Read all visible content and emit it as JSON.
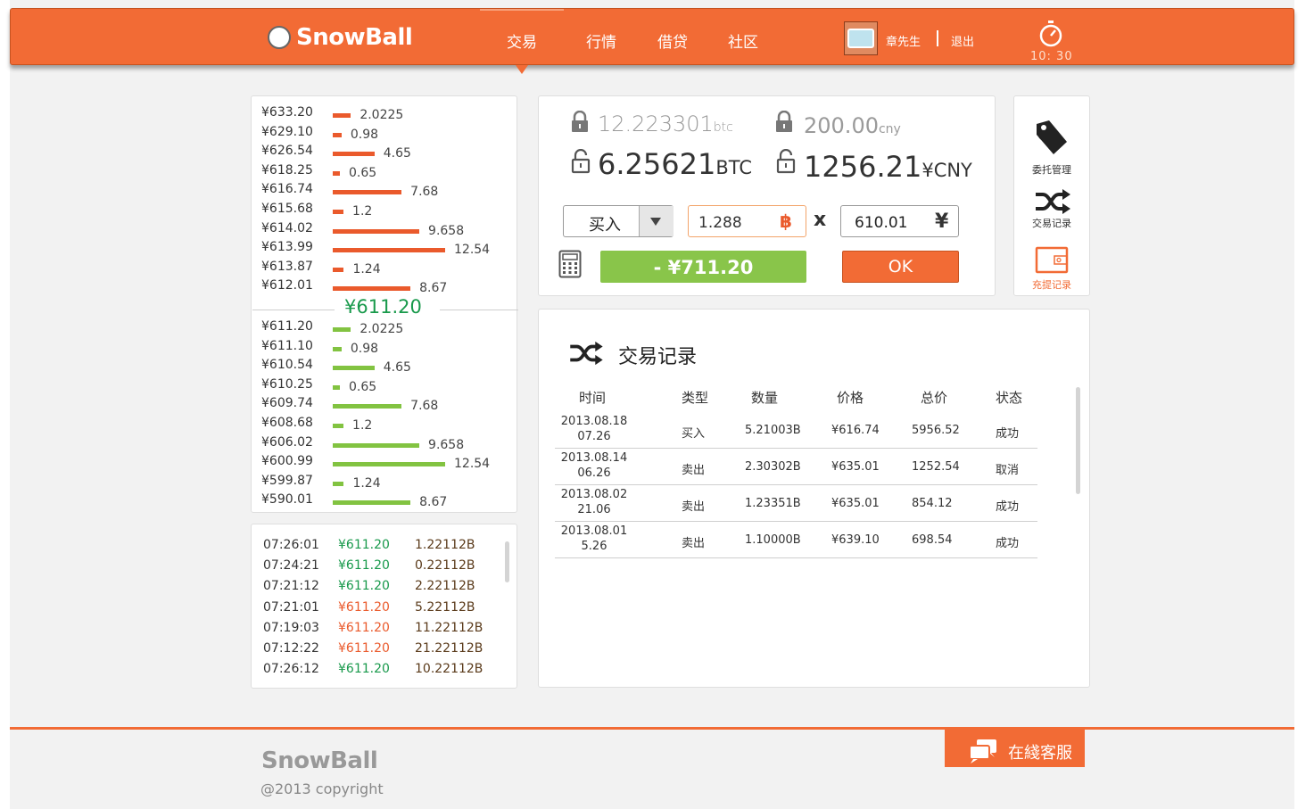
{
  "header": {
    "logo": "SnowBall",
    "nav": [
      "交易",
      "行情",
      "借贷",
      "社区"
    ],
    "active_nav": "交易",
    "username": "章先生",
    "logout": "退出",
    "clock": "10: 30"
  },
  "orderbook": {
    "asks": [
      {
        "price": "¥633.20",
        "qty": "2.0225",
        "amount": 2.0225
      },
      {
        "price": "¥629.10",
        "qty": "0.98",
        "amount": 0.98
      },
      {
        "price": "¥626.54",
        "qty": "4.65",
        "amount": 4.65
      },
      {
        "price": "¥618.25",
        "qty": "0.65",
        "amount": 0.65
      },
      {
        "price": "¥616.74",
        "qty": "7.68",
        "amount": 7.68
      },
      {
        "price": "¥615.68",
        "qty": "1.2",
        "amount": 1.2
      },
      {
        "price": "¥614.02",
        "qty": "9.658",
        "amount": 9.658
      },
      {
        "price": "¥613.99",
        "qty": "12.54",
        "amount": 12.54
      },
      {
        "price": "¥613.87",
        "qty": "1.24",
        "amount": 1.24
      },
      {
        "price": "¥612.01",
        "qty": "8.67",
        "amount": 8.67
      }
    ],
    "mid_price": "¥611.20",
    "bids": [
      {
        "price": "¥611.20",
        "qty": "2.0225",
        "amount": 2.0225
      },
      {
        "price": "¥611.10",
        "qty": "0.98",
        "amount": 0.98
      },
      {
        "price": "¥610.54",
        "qty": "4.65",
        "amount": 4.65
      },
      {
        "price": "¥610.25",
        "qty": "0.65",
        "amount": 0.65
      },
      {
        "price": "¥609.74",
        "qty": "7.68",
        "amount": 7.68
      },
      {
        "price": "¥608.68",
        "qty": "1.2",
        "amount": 1.2
      },
      {
        "price": "¥606.02",
        "qty": "9.658",
        "amount": 9.658
      },
      {
        "price": "¥600.99",
        "qty": "12.54",
        "amount": 12.54
      },
      {
        "price": "¥599.87",
        "qty": "1.24",
        "amount": 1.24
      },
      {
        "price": "¥590.01",
        "qty": "8.67",
        "amount": 8.67
      }
    ]
  },
  "trades": [
    {
      "time": "07:26:01",
      "price": "¥611.20",
      "amount": "1.22112B",
      "dir": "up"
    },
    {
      "time": "07:24:21",
      "price": "¥611.20",
      "amount": "0.22112B",
      "dir": "up"
    },
    {
      "time": "07:21:12",
      "price": "¥611.20",
      "amount": "2.22112B",
      "dir": "up"
    },
    {
      "time": "07:21:01",
      "price": "¥611.20",
      "amount": "5.22112B",
      "dir": "down"
    },
    {
      "time": "07:19:03",
      "price": "¥611.20",
      "amount": "11.22112B",
      "dir": "down"
    },
    {
      "time": "07:12:22",
      "price": "¥611.20",
      "amount": "21.22112B",
      "dir": "down"
    },
    {
      "time": "07:26:12",
      "price": "¥611.20",
      "amount": "10.22112B",
      "dir": "up"
    }
  ],
  "form": {
    "frozen_btc": "12.223301",
    "frozen_btc_unit": "btc",
    "frozen_cny": "200.00",
    "frozen_cny_unit": "cny",
    "avail_btc": "6.25621",
    "avail_btc_unit": "BTC",
    "avail_cny": "1256.21",
    "avail_cny_unit": "¥CNY",
    "type": "买入",
    "amount": "1.288",
    "btc_symbol": "฿",
    "times": "x",
    "price": "610.01",
    "yen_symbol": "¥",
    "total": "- ¥711.20",
    "ok": "OK"
  },
  "side_menu": [
    {
      "label": "委托管理",
      "icon": "tag-icon"
    },
    {
      "label": "交易记录",
      "icon": "shuffle-icon"
    },
    {
      "label": "充提记录",
      "icon": "wallet-icon",
      "active": true
    }
  ],
  "records": {
    "title": "交易记录",
    "headers": [
      "时间",
      "类型",
      "数量",
      "价格",
      "总价",
      "状态"
    ],
    "rows": [
      {
        "date": "2013.08.18",
        "time": "07.26",
        "type": "买入",
        "qty": "5.21003B",
        "price": "¥616.74",
        "total": "5956.52",
        "status": "成功"
      },
      {
        "date": "2013.08.14",
        "time": "06.26",
        "type": "卖出",
        "qty": "2.30302B",
        "price": "¥635.01",
        "total": "1252.54",
        "status": "取消"
      },
      {
        "date": "2013.08.02",
        "time": "21.06",
        "type": "卖出",
        "qty": "1.23351B",
        "price": "¥635.01",
        "total": "854.12",
        "status": "成功"
      },
      {
        "date": "2013.08.01",
        "time": "5.26",
        "type": "卖出",
        "qty": "1.10000B",
        "price": "¥639.10",
        "total": "698.54",
        "status": "成功"
      }
    ]
  },
  "footer": {
    "logo": "SnowBall",
    "copyright": "@2013 copyright",
    "support": "在綫客服"
  },
  "colors": {
    "brand": "#f26b35",
    "ask": "#ea5a2c",
    "bid": "#82c341",
    "up": "#18994b"
  }
}
